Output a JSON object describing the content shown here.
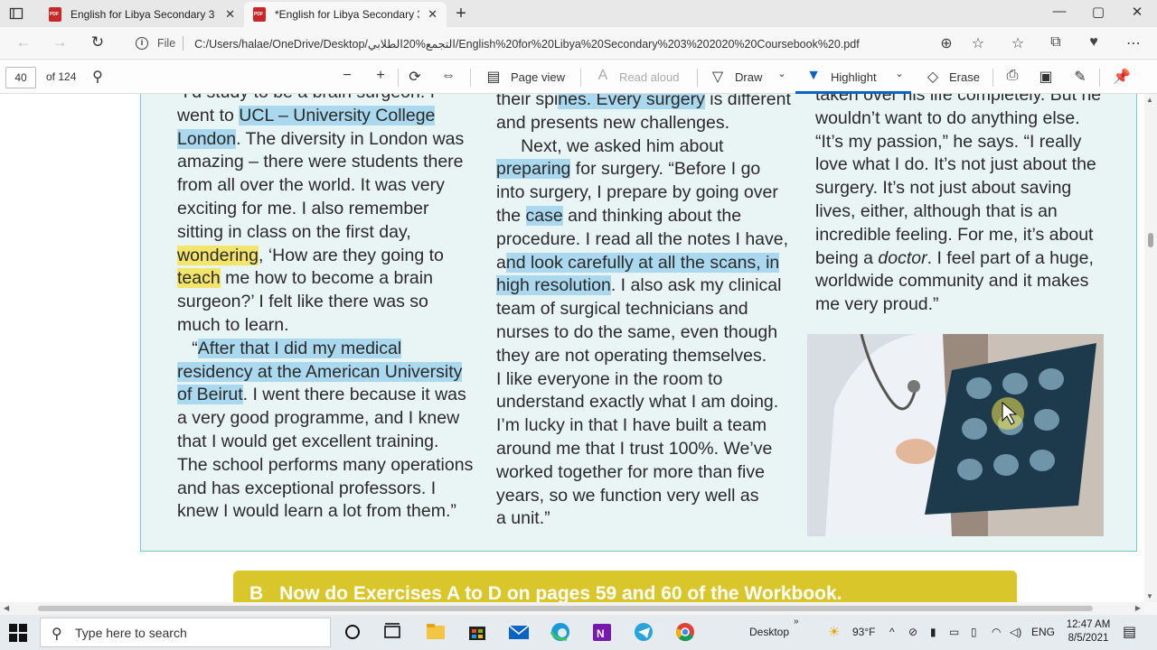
{
  "tabs": [
    {
      "title": "English for Libya Secondary 3 2020 Coursebook .pdf",
      "close": "✕"
    },
    {
      "title": "*English for Libya Secondary 3 2020 Coursebook .pdf",
      "close": "✕"
    }
  ],
  "new_tab": "+",
  "window_controls": {
    "minimize": "—",
    "maximize": "▢",
    "close": "✕"
  },
  "address": {
    "scheme_label": "File",
    "url": "C:/Users/halae/OneDrive/Desktop/التجمع%20الطلابي/English%20for%20Libya%20Secondary%203%202020%20Coursebook%20.pdf"
  },
  "pdf_toolbar": {
    "page_number": "40",
    "page_total": "of 124",
    "page_view": "Page view",
    "read_aloud": "Read aloud",
    "draw": "Draw",
    "highlight": "Highlight",
    "erase": "Erase",
    "highlight_color": "#0a64c2"
  },
  "document": {
    "col1": [
      "“I’d study to be a brain surgeon. I",
      "went to ",
      "UCL – University College",
      "London",
      ". The diversity in London was",
      "amazing – there were students there",
      "from all over the world. It was very",
      "exciting for me. I also remember",
      "sitting in class on the first day,",
      "wondering",
      ", ‘How are they going to",
      "teach",
      " me how to become a brain",
      "surgeon?’ I felt like there was so",
      "much to learn.",
      "“",
      "After that I did my medical",
      "residency at the American University",
      "of Beirut",
      ". I went there because it was",
      "a very good programme, and I knew",
      "that I would get excellent training.",
      "The school performs many operations",
      "and has exceptional professors. I",
      "knew I would learn a lot from them.”"
    ],
    "col2": [
      "their spi",
      "nes. Every surgery",
      " is different",
      "and presents new challenges.",
      "Next, we asked him about",
      "preparing",
      " for surgery. “Before I go",
      "into surgery, I prepare by going over",
      "the ",
      "case",
      " and thinking about the",
      "procedure. I read all the notes I have,",
      "a",
      "nd look carefully at all the scans, in",
      "high resolution",
      ". I also ask my clinical",
      "team of surgical technicians and",
      "nurses to do the same, even though",
      "they are not operating themselves.",
      "I like everyone in the room to",
      "understand exactly what I am doing.",
      "I’m lucky in that I have built a team",
      "around me that I trust 100%. We’ve",
      "worked together for more than five",
      "years, so we function very well as",
      "a unit.”"
    ],
    "col3": [
      "taken over his life completely. But he",
      "wouldn’t want to do anything else.",
      "“It’s my passion,” he says. “I really",
      "love what I do. It’s not just about the",
      "surgery. It’s not just about saving",
      "lives, either, although that is an",
      "incredible feeling. For me, it’s about",
      "being a ",
      "doctor",
      ". I feel part of a huge,",
      "worldwide community and it makes",
      "me very proud.”"
    ],
    "banner_letter": "B",
    "banner_text": "Now do Exercises A to D on pages 59 and 60 of the Workbook."
  },
  "taskbar": {
    "search_placeholder": "Type here to search",
    "desktop_label": "Desktop",
    "weather": "93°F",
    "language": "ENG",
    "time": "12:47 AM",
    "date": "8/5/2021"
  },
  "colors": {
    "highlight_blue": "#a9d8ef",
    "highlight_yellow": "#f3e46b",
    "page_tint": "#e9f4f5",
    "banner": "#d9c62a"
  }
}
